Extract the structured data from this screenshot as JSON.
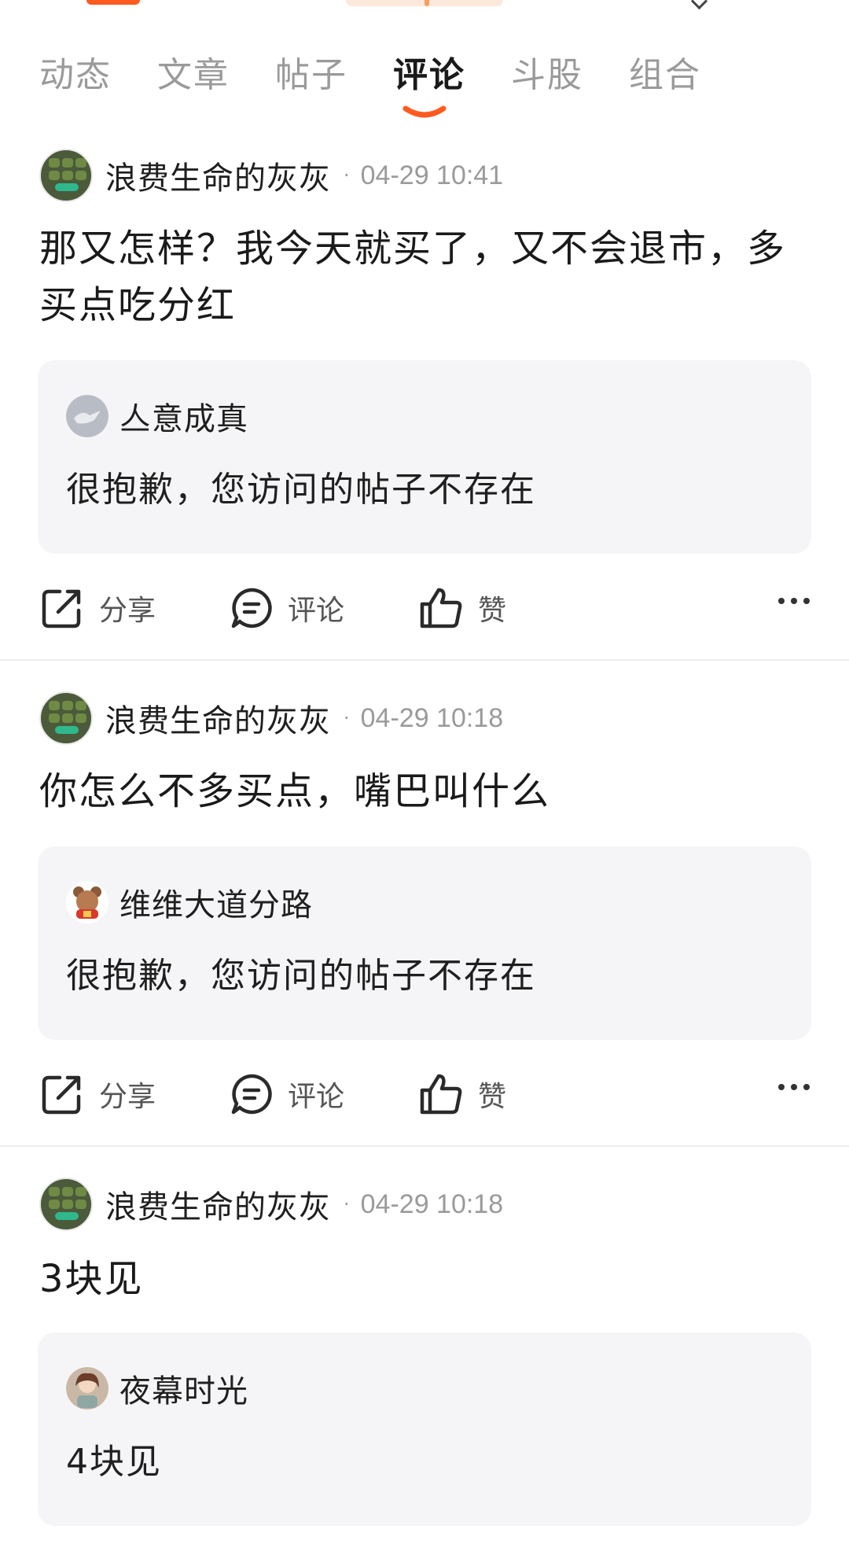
{
  "tabs": [
    {
      "label": "动态"
    },
    {
      "label": "文章"
    },
    {
      "label": "帖子"
    },
    {
      "label": "评论"
    },
    {
      "label": "斗股"
    },
    {
      "label": "组合"
    }
  ],
  "active_tab": "评论",
  "colors": {
    "accent": "#ff5a1f",
    "muted": "#9a9a9a",
    "quote_bg": "#f5f5f7"
  },
  "actions": {
    "share": "分享",
    "comment": "评论",
    "like": "赞"
  },
  "comments": [
    {
      "user": "浪费生命的灰灰",
      "dot": "·",
      "time": "04-29 10:41",
      "content": "那又怎样？我今天就买了，又不会退市，多买点吃分红",
      "quote": {
        "user": "亼意成真",
        "text": "很抱歉，您访问的帖子不存在"
      }
    },
    {
      "user": "浪费生命的灰灰",
      "dot": "·",
      "time": "04-29 10:18",
      "content": "你怎么不多买点，嘴巴叫什么",
      "quote": {
        "user": "维维大道分路",
        "text": "很抱歉，您访问的帖子不存在"
      }
    },
    {
      "user": "浪费生命的灰灰",
      "dot": "·",
      "time": "04-29 10:18",
      "content": "3块见",
      "quote": {
        "user": "夜幕时光",
        "text": "4块见"
      }
    }
  ]
}
